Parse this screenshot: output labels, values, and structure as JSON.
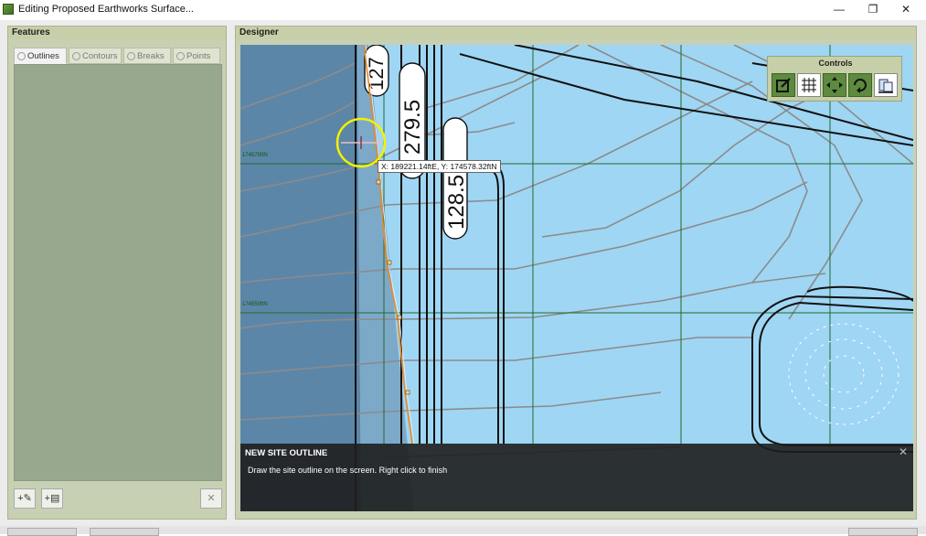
{
  "window": {
    "title": "Editing Proposed Earthworks Surface...",
    "minimize": "—",
    "maximize": "❐",
    "close": "✕"
  },
  "features": {
    "header": "Features",
    "tabs": [
      {
        "label": "Outlines",
        "active": true,
        "icon": "outline-icon"
      },
      {
        "label": "Contours",
        "active": false,
        "icon": "contour-icon"
      },
      {
        "label": "Breaks",
        "active": false,
        "icon": "breakline-icon"
      },
      {
        "label": "Points",
        "active": false,
        "icon": "points-icon"
      }
    ],
    "buttons": {
      "add_outline": "+✎",
      "add_from_file": "+▤",
      "delete": "✕"
    }
  },
  "designer": {
    "header": "Designer",
    "controls_title": "Controls",
    "controls": [
      "edit-icon",
      "grid-icon",
      "pan-icon",
      "rotate-icon",
      "layers-icon"
    ],
    "coordinate_readout": "X: 189221.14ftE, Y: 174578.32ftN",
    "grid_labels": [
      "174575ftN",
      "174550ftN"
    ],
    "contour_labels": [
      "127",
      "279.5",
      "128.5"
    ],
    "overlay": {
      "title": "NEW SITE OUTLINE",
      "text": "Draw the site outline on the screen.  Right click to finish",
      "close": "✕"
    }
  },
  "colors": {
    "map_water": "#9fd6f4",
    "map_dark": "#5c86a8",
    "panel_header": "#c6cfa8",
    "features_body": "#98a88e",
    "grid_line": "#1f6a2c",
    "control_green": "#5d8a3e",
    "cursor_ring": "#f2f200"
  }
}
